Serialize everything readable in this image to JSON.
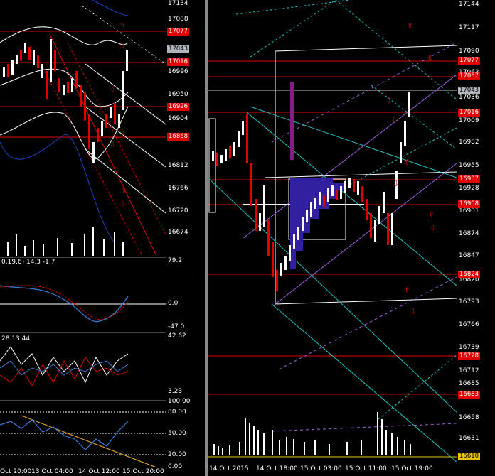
{
  "left_chart": {
    "price_ticks": [
      "17134",
      "17088",
      "17043",
      "16996",
      "16950",
      "16904",
      "16858",
      "16812",
      "16766",
      "16720",
      "16674"
    ],
    "price_tags": [
      {
        "value": "17077",
        "style": "red"
      },
      {
        "value": "17043",
        "style": "gray"
      },
      {
        "value": "17016",
        "style": "red"
      },
      {
        "value": "16926",
        "style": "red"
      },
      {
        "value": "16868",
        "style": "red"
      }
    ],
    "time_ticks": [
      "Oct 20:00",
      "13 Oct 04:00",
      "14 Oct 12:00",
      "15 Oct 20:00"
    ],
    "indicator1": {
      "label": "0,19,6) 14.3 -1.7",
      "ticks": [
        "79.2",
        "0.0",
        "-47.0"
      ]
    },
    "indicator2": {
      "label": "28 13.44",
      "ticks": [
        "42.62",
        "3.23"
      ]
    },
    "indicator3": {
      "ticks": [
        "100.00",
        "80.00",
        "50.00",
        "20.00",
        "0.00"
      ]
    }
  },
  "right_chart": {
    "price_ticks": [
      "17144",
      "17117",
      "17090",
      "17063",
      "17036",
      "17009",
      "16982",
      "16955",
      "16928",
      "16901",
      "16874",
      "16847",
      "16820",
      "16793",
      "16766",
      "16739",
      "16712",
      "16685",
      "16658",
      "16631"
    ],
    "price_tags": [
      {
        "value": "17077",
        "style": "red"
      },
      {
        "value": "17057",
        "style": "red"
      },
      {
        "value": "17043",
        "style": "gray"
      },
      {
        "value": "17016",
        "style": "red"
      },
      {
        "value": "16937",
        "style": "red"
      },
      {
        "value": "16908",
        "style": "red"
      },
      {
        "value": "16824",
        "style": "red"
      },
      {
        "value": "16728",
        "style": "red"
      },
      {
        "value": "16683",
        "style": "red"
      },
      {
        "value": "16610",
        "style": "yellow"
      }
    ],
    "time_ticks": [
      "14 Oct 2015",
      "14 Oct 18:00",
      "15 Oct 03:00",
      "15 Oct 11:00",
      "15 Oct 19:00"
    ]
  },
  "colors": {
    "background": "#000000",
    "level_line": "#e00000",
    "candle_up": "#ffffff",
    "candle_down": "#e00000",
    "volume_profile": "#3020a0"
  }
}
